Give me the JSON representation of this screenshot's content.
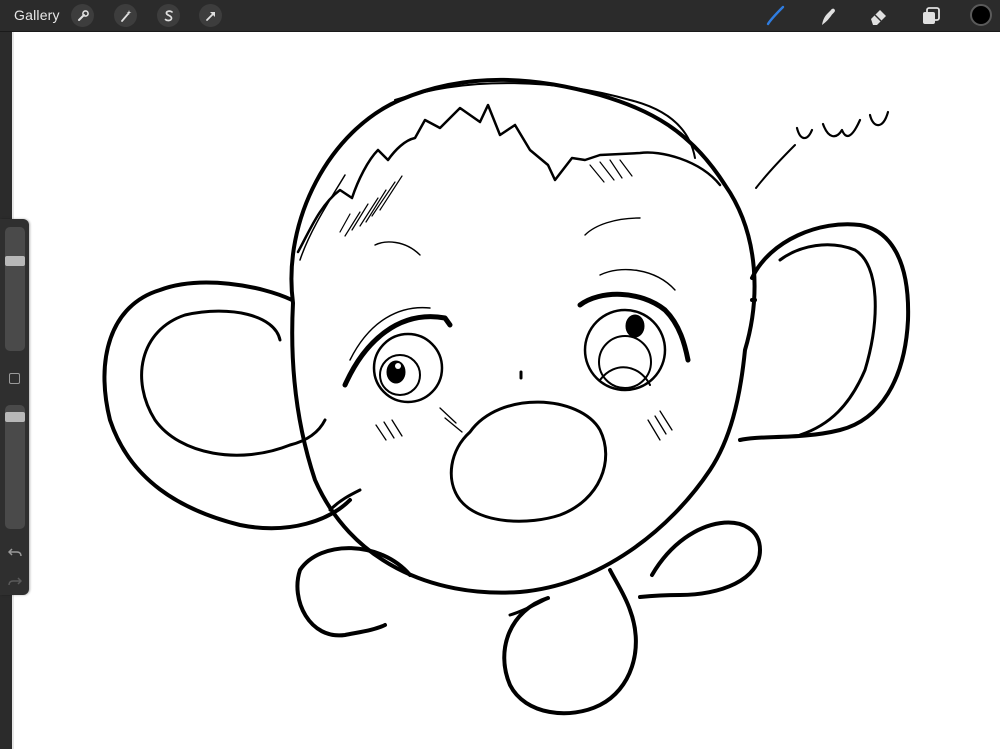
{
  "toolbar": {
    "gallery_label": "Gallery",
    "left_tools": [
      "wrench-icon",
      "magic-wand-icon",
      "selection-s-icon",
      "transform-arrow-icon"
    ],
    "right_tools": [
      "brush-icon",
      "smudge-icon",
      "eraser-icon",
      "layers-icon"
    ],
    "active_tool": "brush",
    "active_tool_color": "#2f7de1",
    "current_color": "#000000"
  },
  "sidebar": {
    "brush_size_level": 0.25,
    "opacity_level": 0.06,
    "undo_icon": "undo-arrow-icon",
    "redo_icon": "redo-arrow-icon"
  },
  "canvas": {
    "background": "#ffffff",
    "annotation_text": "UWU"
  }
}
